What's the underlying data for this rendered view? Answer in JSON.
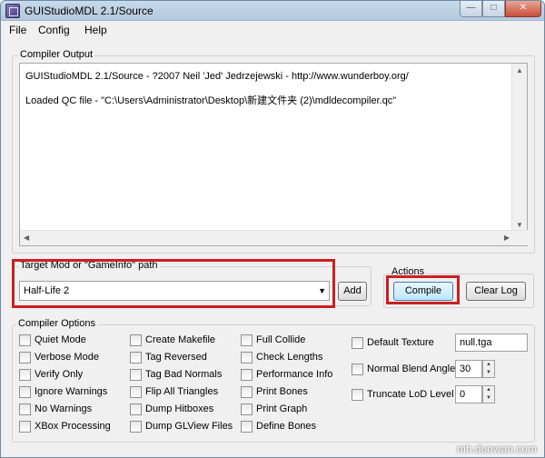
{
  "window": {
    "title": "GUIStudioMDL 2.1/Source",
    "buttons": {
      "minimize": "—",
      "maximize": "□",
      "close": "✕"
    }
  },
  "menu": [
    "File",
    "Config",
    "Help"
  ],
  "compiler_output": {
    "title": "Compiler Output",
    "lines": [
      "GUIStudioMDL 2.1/Source - ?2007 Neil 'Jed' Jedrzejewski - http://www.wunderboy.org/",
      "Loaded QC file - \"C:\\Users\\Administrator\\Desktop\\新建文件夹 (2)\\mdldecompiler.qc\""
    ]
  },
  "target": {
    "title": "Target Mod or \"GameInfo\" path",
    "selected": "Half-Life 2",
    "add_label": "Add"
  },
  "actions": {
    "title": "Actions",
    "compile_label": "Compile",
    "clear_log_label": "Clear Log"
  },
  "compiler_options": {
    "title": "Compiler Options",
    "col1": [
      "Quiet Mode",
      "Verbose Mode",
      "Verify Only",
      "Ignore Warnings",
      "No Warnings",
      "XBox Processing"
    ],
    "col2": [
      "Create Makefile",
      "Tag Reversed",
      "Tag Bad Normals",
      "Flip All Triangles",
      "Dump Hitboxes",
      "Dump GLView Files"
    ],
    "col3": [
      "Full Collide",
      "Check Lengths",
      "Performance Info",
      "Print Bones",
      "Print Graph",
      "Define Bones"
    ],
    "default_texture": {
      "label": "Default Texture",
      "value": "null.tga"
    },
    "normal_blend_angle": {
      "label": "Normal Blend Angle",
      "value": "30"
    },
    "truncate_lod_level": {
      "label": "Truncate LoD Level",
      "value": "0"
    }
  },
  "watermark": "mh.duowan.com"
}
